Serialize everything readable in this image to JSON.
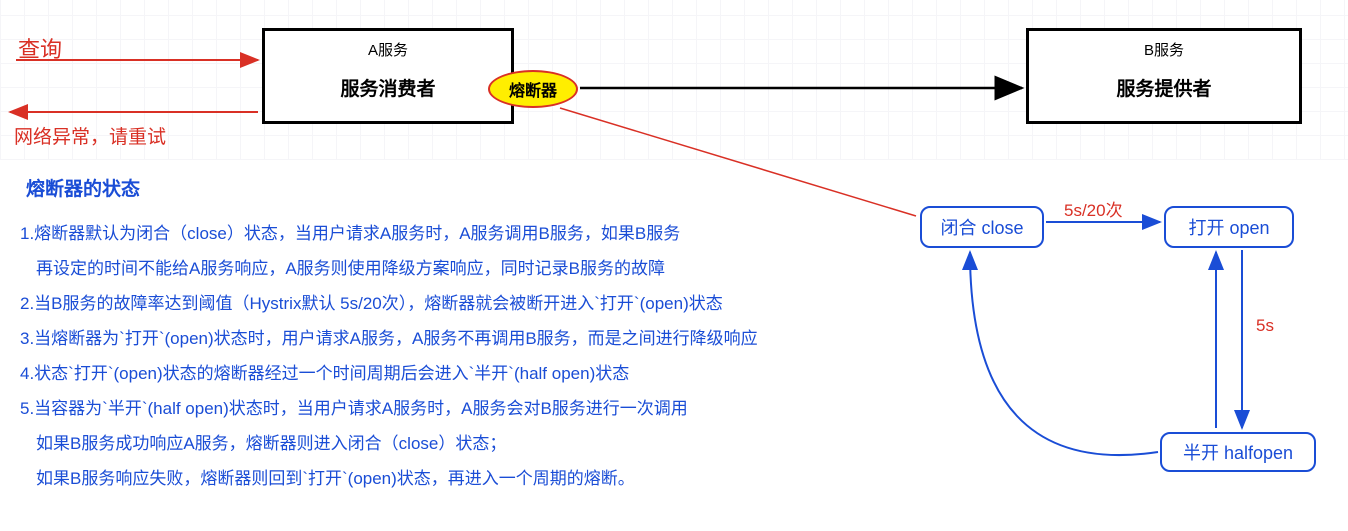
{
  "topDiagram": {
    "queryLabel": "查询",
    "errorLabel": "网络异常，请重试",
    "serviceA": {
      "title": "A服务",
      "subtitle": "服务消费者"
    },
    "serviceB": {
      "title": "B服务",
      "subtitle": "服务提供者"
    },
    "breaker": "熔断器"
  },
  "section": {
    "title": "熔断器的状态",
    "lines": [
      "1.熔断器默认为闭合（close）状态，当用户请求A服务时，A服务调用B服务，如果B服务",
      "再设定的时间不能给A服务响应，A服务则使用降级方案响应，同时记录B服务的故障",
      "2.当B服务的故障率达到阈值（Hystrix默认 5s/20次），熔断器就会被断开进入`打开`(open)状态",
      "3.当熔断器为`打开`(open)状态时，用户请求A服务，A服务不再调用B服务，而是之间进行降级响应",
      "4.状态`打开`(open)状态的熔断器经过一个时间周期后会进入`半开`(half open)状态",
      "5.当容器为`半开`(half open)状态时，当用户请求A服务时，A服务会对B服务进行一次调用",
      "如果B服务成功响应A服务，熔断器则进入闭合（close）状态；",
      "如果B服务响应失败，熔断器则回到`打开`(open)状态，再进入一个周期的熔断。"
    ]
  },
  "stateDiagram": {
    "close": "闭合 close",
    "open": "打开  open",
    "half": "半开 halfopen",
    "label_5s20": "5s/20次",
    "label_5s": "5s"
  },
  "colors": {
    "red": "#d93025",
    "blue": "#1a4dd6",
    "yellow": "#ffee00"
  }
}
